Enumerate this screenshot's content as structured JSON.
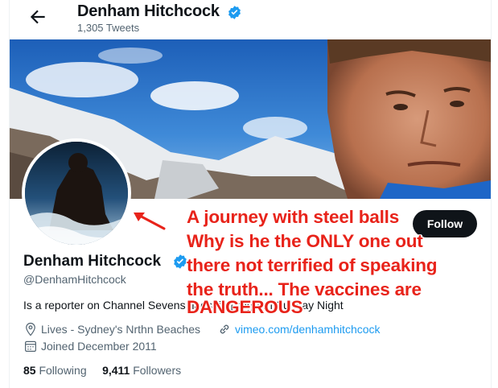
{
  "header": {
    "name": "Denham Hitchcock",
    "tweet_count": "1,305 Tweets"
  },
  "profile": {
    "name": "Denham Hitchcock",
    "handle": "@DenhamHitchcock",
    "bio": "Is a reporter on Channel Sevens flagship program Sunday Night",
    "location": "Lives - Sydney's Nrthn Beaches",
    "website": "vimeo.com/denhamhitchcock",
    "joined": "Joined December 2011",
    "following_count": "85",
    "following_label": "Following",
    "followers_count": "9,411",
    "followers_label": "Followers"
  },
  "follow_button": {
    "label": "Follow"
  },
  "annotation": {
    "lines": [
      "A journey with steel balls",
      "Why is he the ONLY one out",
      "there not terrified of speaking",
      "the truth... The vaccines are",
      "DANGEROUS"
    ]
  },
  "colors": {
    "accent": "#1d9bf0",
    "follow_bg": "#0f1419",
    "annotation": "#e8231a"
  }
}
